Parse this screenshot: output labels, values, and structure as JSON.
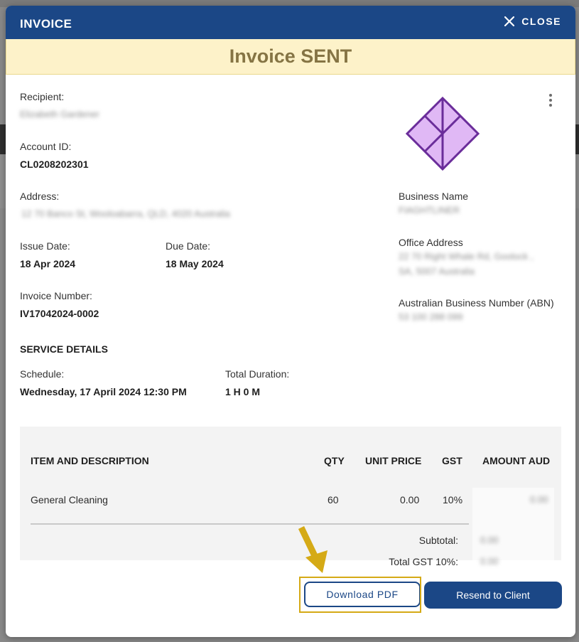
{
  "modal": {
    "title": "INVOICE",
    "close_label": "CLOSE",
    "status_banner": "Invoice SENT"
  },
  "recipient": {
    "recipient_label": "Recipient:",
    "recipient_value": "Elizabeth Gardener",
    "account_label": "Account ID:",
    "account_value": "CL0208202301",
    "address_label": "Address:",
    "address_value": "12 70 Banco St, Wooloabarra, QLD, 4020 Australia",
    "issue_label": "Issue Date:",
    "issue_value": "18 Apr 2024",
    "due_label": "Due Date:",
    "due_value": "18 May 2024",
    "invoice_label": "Invoice Number:",
    "invoice_value": "IV17042024-0002"
  },
  "business": {
    "name_label": "Business Name",
    "name_value": "FIAGHTLINER",
    "office_label": "Office Address",
    "office_value_line1": "22 70 Right Whale Rd, Goolock ,",
    "office_value_line2": "SA, 5007 Australia",
    "abn_label": "Australian Business Number (ABN)",
    "abn_value": "53 100 288 099"
  },
  "service": {
    "title": "SERVICE DETAILS",
    "schedule_label": "Schedule:",
    "schedule_value": "Wednesday, 17 April 2024 12:30 PM",
    "duration_label": "Total Duration:",
    "duration_value": "1 H 0 M"
  },
  "table": {
    "headers": {
      "item": "ITEM AND DESCRIPTION",
      "qty": "QTY",
      "unit_price": "UNIT PRICE",
      "gst": "GST",
      "amount": "AMOUNT AUD"
    },
    "rows": [
      {
        "item": "General Cleaning",
        "qty": "60",
        "unit_price": "0.00",
        "gst": "10%",
        "amount": "0.00"
      }
    ],
    "subtotal_label": "Subtotal:",
    "subtotal_value": "0.00",
    "total_gst_label": "Total GST 10%:",
    "total_gst_value": "0.00"
  },
  "actions": {
    "download_label": "Download PDF",
    "resend_label": "Resend to Client"
  },
  "colors": {
    "header_bg": "#1b4786",
    "banner_bg": "#fdf2c9",
    "banner_text": "#857444",
    "highlight": "#d5aa16",
    "logo_fill": "#e0b8f5",
    "logo_stroke": "#6a2d9a"
  }
}
